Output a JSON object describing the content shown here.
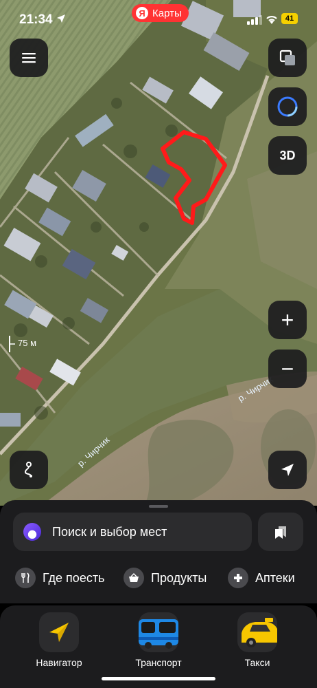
{
  "status_bar": {
    "time": "21:34",
    "battery": "41"
  },
  "app": {
    "brand_logo": "Я",
    "brand_name": "Карты"
  },
  "map": {
    "scale_label": "75 м",
    "river_labels": [
      "р. Чирчик",
      "р. Чирчик"
    ],
    "buttons": {
      "menu": "menu-icon",
      "layers": "layers-icon",
      "alice": "alice-icon",
      "three_d": "3D",
      "zoom_in": "+",
      "zoom_out": "−",
      "route": "route-icon",
      "my_location": "location-arrow-icon"
    }
  },
  "sheet": {
    "search_placeholder": "Поиск и выбор мест",
    "chips": [
      {
        "label": "Где поесть",
        "icon": "cutlery-icon"
      },
      {
        "label": "Продукты",
        "icon": "basket-icon"
      },
      {
        "label": "Аптеки",
        "icon": "pharmacy-cross-icon"
      }
    ]
  },
  "tabs": [
    {
      "label": "Навигатор",
      "icon": "navigator-arrow-icon"
    },
    {
      "label": "Транспорт",
      "icon": "bus-icon"
    },
    {
      "label": "Такси",
      "icon": "taxi-car-icon"
    }
  ],
  "colors": {
    "accent_red": "#ff3333",
    "sheet_bg": "#1c1c1e",
    "button_bg": "#2c2c2e",
    "battery": "#f5d000",
    "outline": "#ff1a1a"
  }
}
